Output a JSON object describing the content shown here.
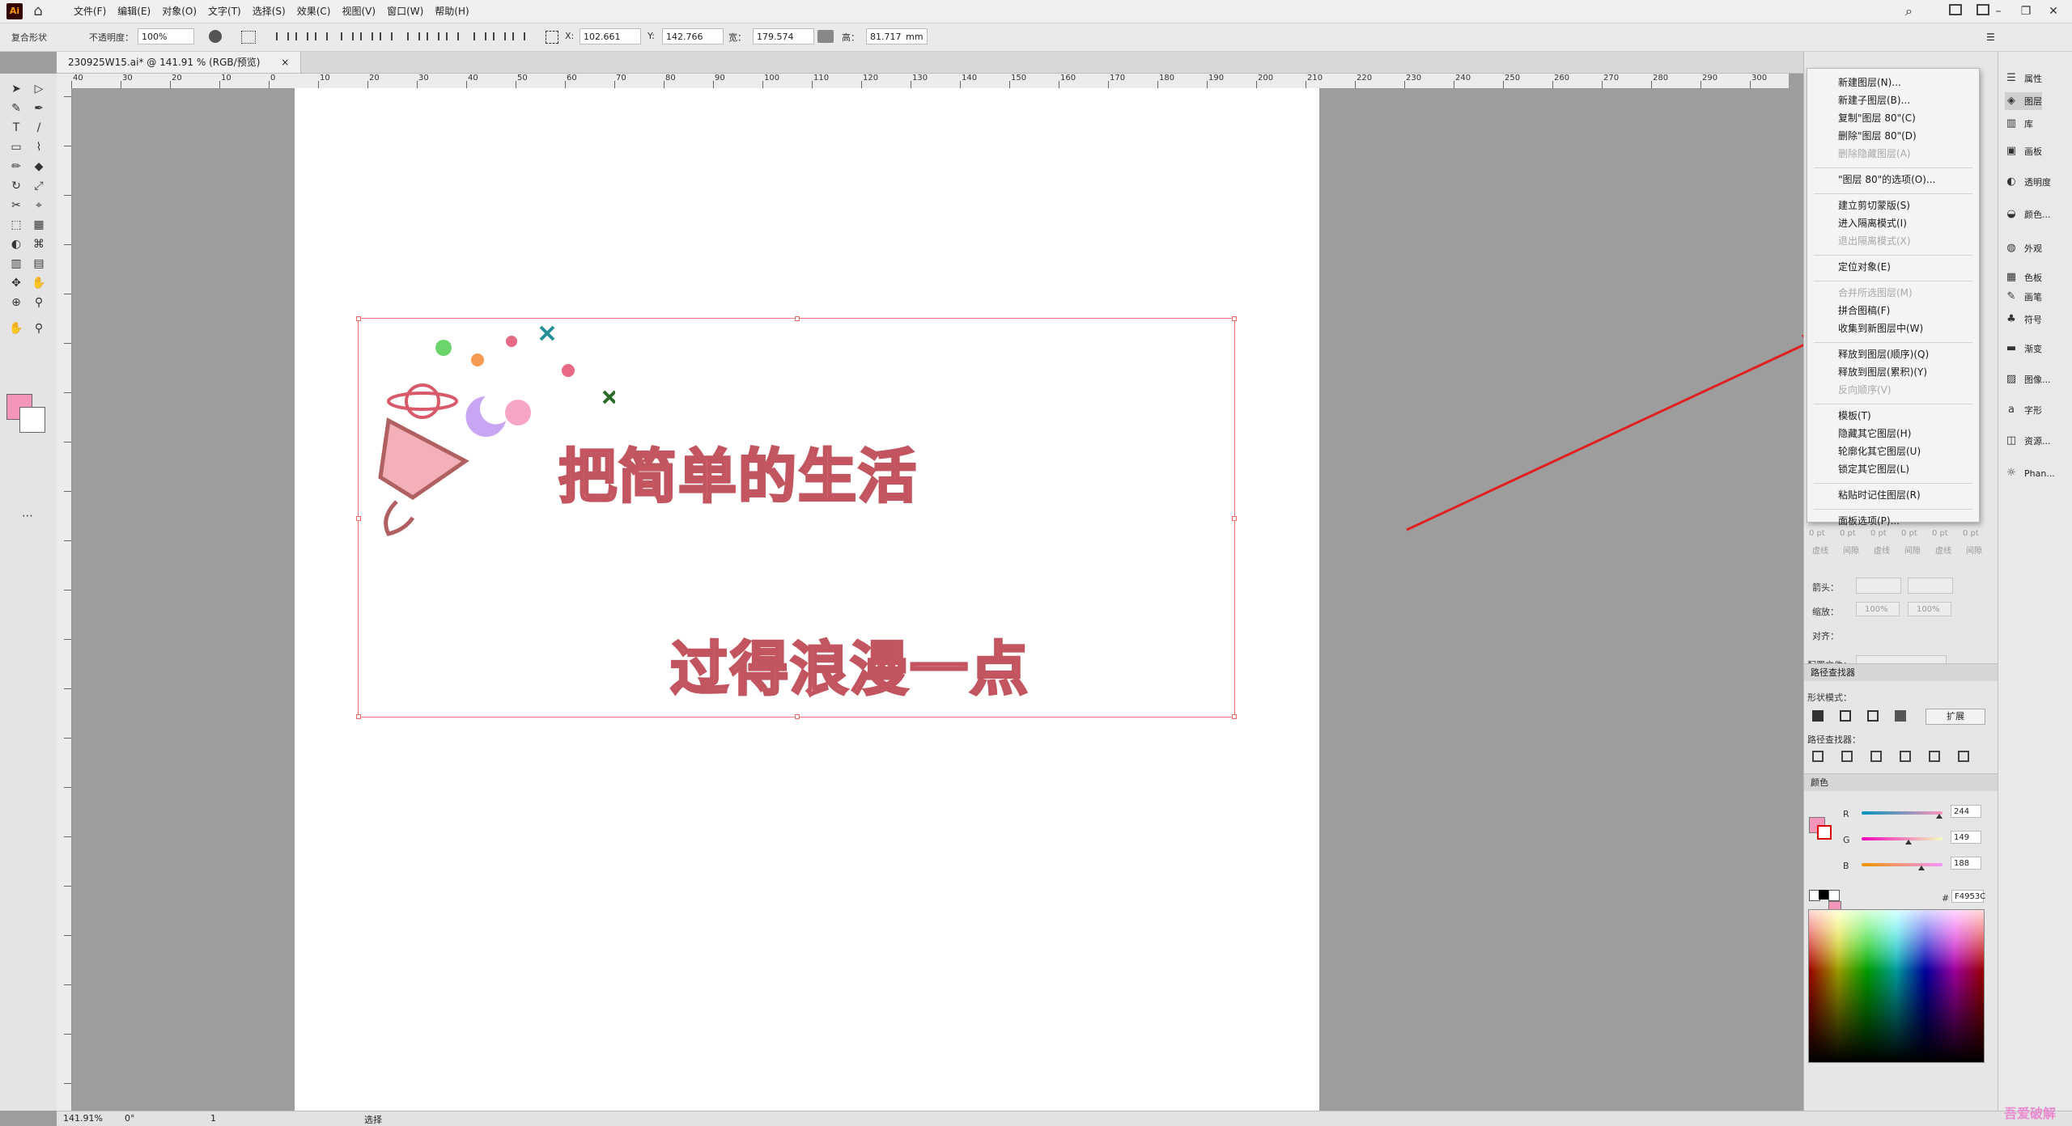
{
  "app": {
    "logo": "Ai",
    "home_icon": "home-icon"
  },
  "menus": [
    "文件(F)",
    "编辑(E)",
    "对象(O)",
    "文字(T)",
    "选择(S)",
    "效果(C)",
    "视图(V)",
    "窗口(W)",
    "帮助(H)"
  ],
  "control": {
    "shape_label": "复合形状",
    "opacity_label": "不透明度：",
    "opacity_value": "100%",
    "x_label": "X:",
    "x_value": "102.661  ",
    "y_label": "Y:",
    "y_value": "142.766  ",
    "w_label": "宽：",
    "w_value": "179.574  ",
    "h_label": "高：",
    "h_value": "81.717  mm"
  },
  "document": {
    "tab_title": "230925W15.ai* @ 141.91 % (RGB/预览)",
    "close": "×"
  },
  "ruler_labels": [
    "40",
    "30",
    "20",
    "10",
    "0",
    "10",
    "20",
    "30",
    "40",
    "50",
    "60",
    "70",
    "80",
    "90",
    "100",
    "110",
    "120",
    "130",
    "140",
    "150",
    "160",
    "170",
    "180",
    "190",
    "200",
    "210",
    "220",
    "230",
    "240",
    "250",
    "260",
    "270",
    "280",
    "290",
    "300"
  ],
  "artwork": {
    "line1": "把简单的生活",
    "line2": "过得浪漫一点"
  },
  "context_menu": {
    "items": [
      {
        "label": "新建图层(N)...",
        "disabled": false
      },
      {
        "label": "新建子图层(B)...",
        "disabled": false
      },
      {
        "label": "复制\"图层 80\"(C)",
        "disabled": false
      },
      {
        "label": "删除\"图层 80\"(D)",
        "disabled": false
      },
      {
        "label": "删除隐藏图层(A)",
        "disabled": true
      },
      {
        "label": "\"图层 80\"的选项(O)...",
        "disabled": false
      },
      {
        "label": "建立剪切蒙版(S)",
        "disabled": false
      },
      {
        "label": "进入隔离模式(I)",
        "disabled": false
      },
      {
        "label": "退出隔离模式(X)",
        "disabled": true
      },
      {
        "label": "定位对象(E)",
        "disabled": false
      },
      {
        "label": "合并所选图层(M)",
        "disabled": true
      },
      {
        "label": "拼合图稿(F)",
        "disabled": false
      },
      {
        "label": "收集到新图层中(W)",
        "disabled": false
      },
      {
        "label": "释放到图层(顺序)(Q)",
        "disabled": false
      },
      {
        "label": "释放到图层(累积)(Y)",
        "disabled": false
      },
      {
        "label": "反向顺序(V)",
        "disabled": true
      },
      {
        "label": "模板(T)",
        "disabled": false
      },
      {
        "label": "隐藏其它图层(H)",
        "disabled": false
      },
      {
        "label": "轮廓化其它图层(U)",
        "disabled": false
      },
      {
        "label": "锁定其它图层(L)",
        "disabled": false
      },
      {
        "label": "粘贴时记住图层(R)",
        "disabled": false
      },
      {
        "label": "面板选项(P)...",
        "disabled": false
      }
    ]
  },
  "icon_strip": [
    {
      "label": "属性",
      "icon": "properties-icon"
    },
    {
      "label": "图层",
      "icon": "layers-icon"
    },
    {
      "label": "库",
      "icon": "library-icon"
    },
    {
      "label": "画板",
      "icon": "artboard-icon"
    },
    {
      "label": "透明度",
      "icon": "transparency-icon"
    },
    {
      "label": "颜色...",
      "icon": "color-icon"
    },
    {
      "label": "外观",
      "icon": "appearance-icon"
    },
    {
      "label": "色板",
      "icon": "swatches-icon"
    },
    {
      "label": "画笔",
      "icon": "brush-icon"
    },
    {
      "label": "符号",
      "icon": "symbol-icon"
    },
    {
      "label": "渐变",
      "icon": "gradient-icon"
    },
    {
      "label": "图像...",
      "icon": "image-icon"
    },
    {
      "label": "字形",
      "icon": "glyphs-icon"
    },
    {
      "label": "资源...",
      "icon": "assets-icon"
    },
    {
      "label": "Phan...",
      "icon": "plugin-icon"
    }
  ],
  "stroke_panel": {
    "pt_values": [
      "0 pt",
      "0 pt",
      "0 pt",
      "0 pt",
      "0 pt",
      "0 pt"
    ],
    "pt_labels": [
      "虚线",
      "间隙",
      "虚线",
      "间隙",
      "虚线",
      "间隙"
    ],
    "arrow_label": "箭头：",
    "scale_label": "缩放：",
    "scale_value": "100%",
    "align_label": "对齐：",
    "profile_label": "配置文件："
  },
  "pathfinder": {
    "title": "路径查找器",
    "shape_modes_label": "形状模式：",
    "expand_label": "扩展",
    "pathfinders_label": "路径查找器："
  },
  "color_panel": {
    "title": "颜色",
    "r_label": "R",
    "r_value": "244",
    "g_label": "G",
    "g_value": "149",
    "b_label": "B",
    "b_value": "188",
    "r": 244,
    "g": 149,
    "b": 188,
    "hex_label": "#",
    "hex_value": "F4953C",
    "fill_color": "#f495bc"
  },
  "status": {
    "zoom": "141.91%",
    "rotation": "0°",
    "page": "1",
    "tool": "选择"
  },
  "watermark": "吾爱破解"
}
